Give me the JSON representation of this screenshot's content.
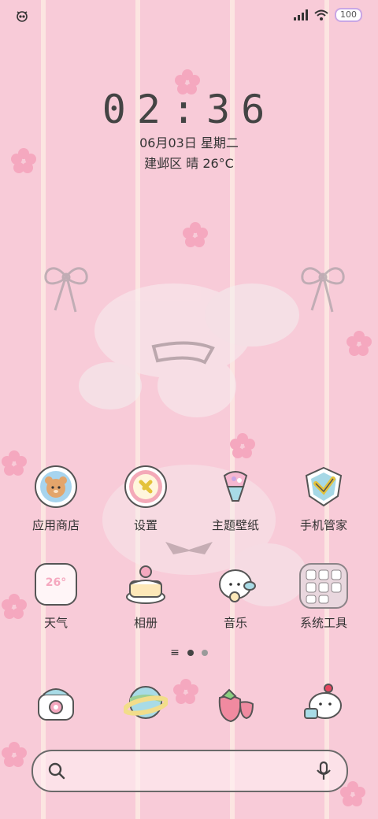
{
  "status": {
    "left_icon": "robot-alarm-icon",
    "signal_icon": "signal-icon",
    "wifi_icon": "wifi-icon",
    "battery_level": "100"
  },
  "clock": {
    "time": "02:36"
  },
  "date": {
    "text": "06月03日 星期二"
  },
  "weather": {
    "text": "建邺区 晴 26°C"
  },
  "apps_row1": [
    {
      "label": "应用商店",
      "icon": "bear-store-icon"
    },
    {
      "label": "设置",
      "icon": "settings-icon"
    },
    {
      "label": "主题壁纸",
      "icon": "theme-icon"
    },
    {
      "label": "手机管家",
      "icon": "shield-check-icon"
    }
  ],
  "apps_row2": [
    {
      "label": "天气",
      "icon": "weather-icon",
      "temp": "26°"
    },
    {
      "label": "相册",
      "icon": "cake-gallery-icon"
    },
    {
      "label": "音乐",
      "icon": "music-bunny-icon"
    },
    {
      "label": "系统工具",
      "icon": "tools-folder-icon"
    }
  ],
  "dock": [
    {
      "icon": "phone-icon"
    },
    {
      "icon": "browser-planet-icon"
    },
    {
      "icon": "strawberry-icon"
    },
    {
      "icon": "camera-cake-icon"
    }
  ],
  "pager": {
    "current": 1,
    "total": 2
  },
  "search": {
    "search_icon": "search-icon",
    "mic_icon": "mic-icon"
  },
  "colors": {
    "background": "#f8cbd8",
    "text": "#333333",
    "accent": "#f5a8bf"
  }
}
